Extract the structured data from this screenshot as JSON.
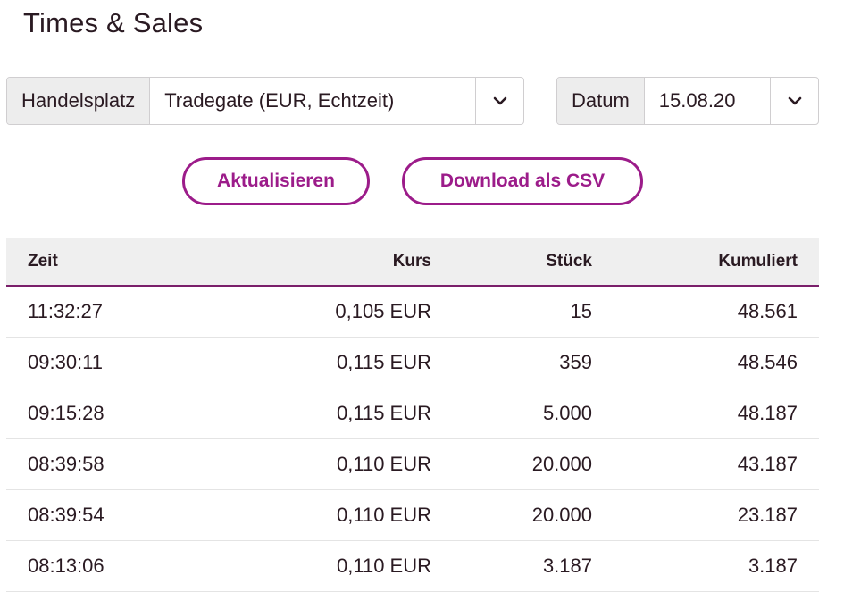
{
  "page": {
    "title": "Times & Sales"
  },
  "venue": {
    "label": "Handelsplatz",
    "value": "Tradegate (EUR, Echtzeit)"
  },
  "date": {
    "label": "Datum",
    "value": "15.08.20"
  },
  "actions": {
    "refresh_label": "Aktualisieren",
    "csv_label": "Download als CSV"
  },
  "table": {
    "headers": {
      "zeit": "Zeit",
      "kurs": "Kurs",
      "stueck": "Stück",
      "kumuliert": "Kumuliert"
    },
    "rows": [
      {
        "zeit": "11:32:27",
        "kurs": "0,105 EUR",
        "stueck": "15",
        "kumuliert": "48.561"
      },
      {
        "zeit": "09:30:11",
        "kurs": "0,115 EUR",
        "stueck": "359",
        "kumuliert": "48.546"
      },
      {
        "zeit": "09:15:28",
        "kurs": "0,115 EUR",
        "stueck": "5.000",
        "kumuliert": "48.187"
      },
      {
        "zeit": "08:39:58",
        "kurs": "0,110 EUR",
        "stueck": "20.000",
        "kumuliert": "43.187"
      },
      {
        "zeit": "08:39:54",
        "kurs": "0,110 EUR",
        "stueck": "20.000",
        "kumuliert": "23.187"
      },
      {
        "zeit": "08:13:06",
        "kurs": "0,110 EUR",
        "stueck": "3.187",
        "kumuliert": "3.187"
      }
    ]
  },
  "icons": {
    "dropdown": "chevron-down-icon"
  },
  "colors": {
    "accent": "#9c1c8a",
    "header_border": "#7a1f6a",
    "header_bg": "#efefef"
  }
}
